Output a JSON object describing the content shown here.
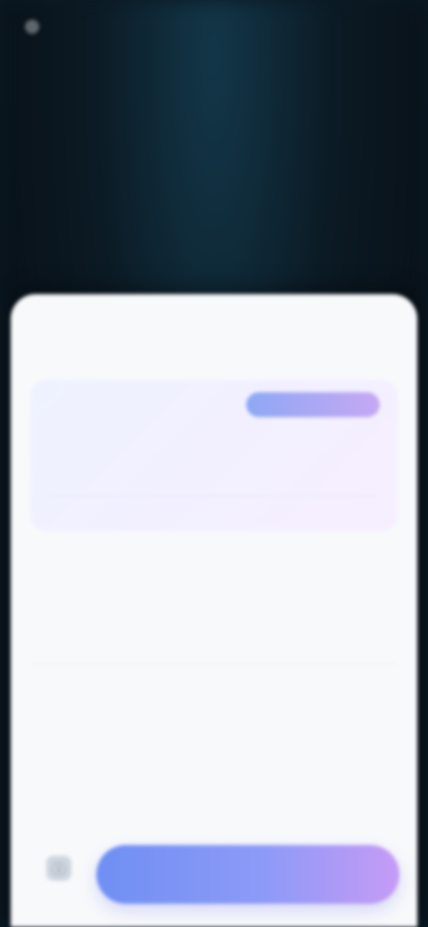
{
  "status_bar": {
    "left_text": "",
    "right_text": ""
  },
  "sheet": {
    "title": "",
    "promo": {
      "badge": "",
      "headline": "",
      "subtext": "",
      "row_left": "",
      "row_right": ""
    },
    "options": [
      {
        "title": "",
        "subtitle": "",
        "tag": "",
        "meta_left": "",
        "meta_right": ""
      },
      {
        "title": "",
        "subtitle": "",
        "tag": "",
        "meta_left": "",
        "meta_right": ""
      }
    ],
    "cta_label": ""
  },
  "colors": {
    "accent_start": "#6f8ff3",
    "accent_end": "#c69bf6",
    "sheet_bg": "#f7f9fb",
    "backdrop": "#0b1a24"
  },
  "icons": {
    "footer_icon": "info-icon"
  }
}
